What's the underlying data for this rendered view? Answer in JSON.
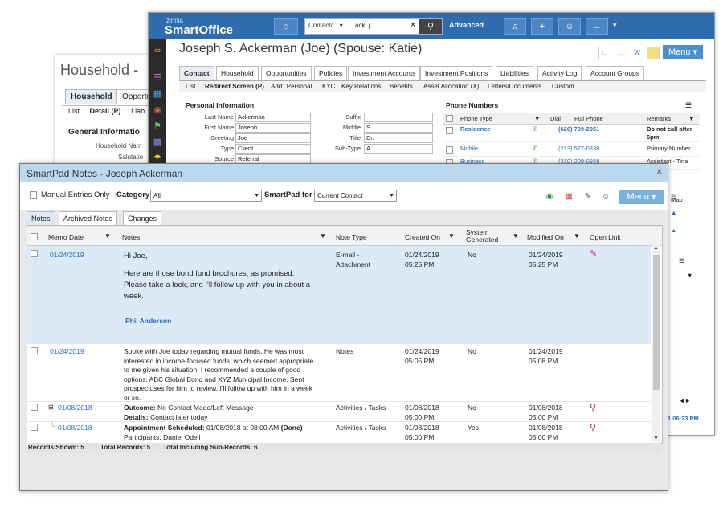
{
  "household_window": {
    "title": "Household -",
    "tabs": [
      "Household",
      "Opportu"
    ],
    "sub_links": [
      "List",
      "Detail (P)",
      "Liab"
    ],
    "section": "General Informatio",
    "fields": [
      "Household Nam",
      "Salutatio"
    ]
  },
  "smartoffice": {
    "logo_top": "zinnia",
    "logo_main": "SmartOffice",
    "search": {
      "scope": "Contact/...",
      "value": "ack, j"
    },
    "advanced": "Advanced",
    "contact_title": "Joseph S. Ackerman (Joe) (Spouse: Katie)",
    "menu": "Menu",
    "tabs": [
      "Contact",
      "Household",
      "Opportunities",
      "Policies",
      "Investment Accounts",
      "Investment Positions",
      "Liabilities",
      "Activity Log",
      "Account Groups"
    ],
    "subtabs": [
      "List",
      "Redirect Screen (P)",
      "Add'l Personal",
      "KYC",
      "Key Relations",
      "Benefits",
      "Asset Allocation (X)",
      "Letters/Documents",
      "Custom"
    ],
    "personal_info": {
      "heading": "Personal Information",
      "labels": [
        "Last Name",
        "First Name",
        "Greeting",
        "Type",
        "Source"
      ],
      "values": [
        "Ackerman",
        "Joseph",
        "Joe",
        "Client",
        "Referral"
      ],
      "labels2": [
        "Suffix",
        "Middle",
        "Title",
        "Sub-Type"
      ],
      "values2": [
        "",
        "S.",
        "Dr.",
        "A"
      ]
    },
    "phone_numbers": {
      "heading": "Phone Numbers",
      "columns": [
        "Phone Type",
        "Dial",
        "Full Phone",
        "Remarks"
      ],
      "rows": [
        {
          "type": "Residence",
          "phone": "(626) 799-2951",
          "remarks": "Do not call after 6pm"
        },
        {
          "type": "Mobile",
          "phone": "(213) 577-0338",
          "remarks": "Primary Number"
        },
        {
          "type": "Business",
          "phone": "(310) 209-0948",
          "remarks": "Assistant - Tina"
        }
      ]
    },
    "right_fragments": {
      "map": "Map",
      "time": "1 06:23 PM"
    }
  },
  "smartpad": {
    "title": "SmartPad Notes - Joseph Ackerman",
    "manual_entries": "Manual Entries Only",
    "category_label": "Category",
    "category_value": "All",
    "smartpad_for_label": "SmartPad for",
    "smartpad_for_value": "Current Contact",
    "menu": "Menu",
    "tabs": [
      "Notes",
      "Archived Notes",
      "Changes"
    ],
    "columns": [
      "Memo Date",
      "Notes",
      "Note Type",
      "Created On",
      "System Generated",
      "Modified On",
      "Open Link"
    ],
    "rows": [
      {
        "memo_date": "01/24/2019",
        "notes": [
          "Hi Joe,",
          "",
          "Here are those bond fund brochures, as promised.",
          "Please take a look, and I'll follow up with you in about a",
          "week."
        ],
        "signature": "Phil Anderson",
        "note_type": [
          "E-mail -",
          "Attachment"
        ],
        "created": [
          "01/24/2019",
          "05:25 PM"
        ],
        "system": "No",
        "modified": [
          "01/24/2019",
          "05:25 PM"
        ]
      },
      {
        "memo_date": "01/24/2019",
        "notes": [
          "Spoke with Joe today regarding mutual funds. He was most",
          "interested in income-focused funds, which seemed appropriate",
          "to me given his situation. I recommended a couple of good",
          "options: ABC Global Bond and XYZ Municipal Income. Sent",
          "prospectuses for him to review. I'll follow up with him in a week",
          "or so."
        ],
        "note_type": [
          "Notes"
        ],
        "created": [
          "01/24/2019",
          "05:05 PM"
        ],
        "system": "No",
        "modified": [
          "01/24/2019",
          "05:08 PM"
        ]
      },
      {
        "memo_date": "01/08/2018",
        "outcome_label": "Outcome:",
        "outcome": "No Contact Made/Left Message",
        "details_label": "Details:",
        "details": "Contact later today",
        "note_type": [
          "Activities / Tasks"
        ],
        "created": [
          "01/08/2018",
          "05:00 PM"
        ],
        "system": "No",
        "modified": [
          "01/08/2018",
          "05:00 PM"
        ]
      },
      {
        "memo_date": "01/08/2018",
        "appt_label": "Appointment Scheduled:",
        "appt": "01/08/2018 at 08:00 AM",
        "appt_status": "(Done)",
        "participants": "Participants: Daniel Odell",
        "note_type": [
          "Activities / Tasks"
        ],
        "created": [
          "01/08/2018",
          "05:00 PM"
        ],
        "system": "Yes",
        "modified": [
          "01/08/2018",
          "05:00 PM"
        ]
      }
    ],
    "status": {
      "records_shown": "Records Shown: 5",
      "total_records": "Total Records: 5",
      "total_sub": "Total Including Sub-Records: 6"
    }
  }
}
